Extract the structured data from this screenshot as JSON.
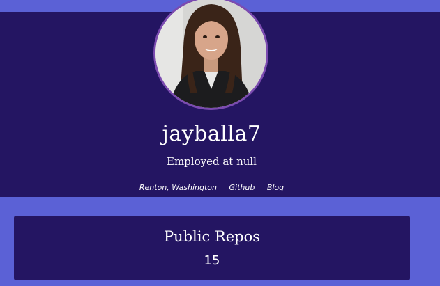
{
  "profile": {
    "username": "jayballa7",
    "employment": "Employed at null",
    "location": "Renton, Washington",
    "github_link": "Github",
    "blog_link": "Blog",
    "avatar_icon": "profile-photo"
  },
  "stats": {
    "public_repos_label": "Public Repos",
    "public_repos_value": "15"
  },
  "colors": {
    "background": "#5b61d6",
    "panel": "#241562",
    "avatar_border": "#7b4bb0",
    "text": "#ffffff"
  }
}
